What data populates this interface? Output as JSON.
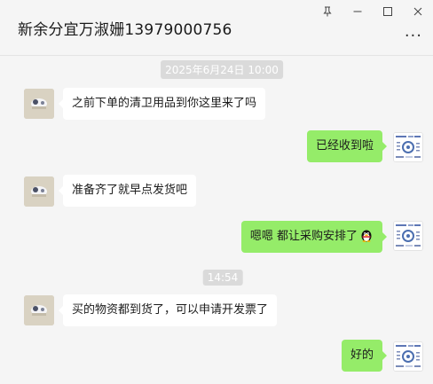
{
  "window": {
    "title": "新余分宜万淑姗13979000756",
    "more_label": "···",
    "controls": {
      "pin_glyph": "⚲",
      "minimize_glyph": "—",
      "maximize_glyph": "☐",
      "close_glyph": "✕"
    }
  },
  "messages": {
    "time1": "2025年6月24日 10:00",
    "m1": "之前下单的清卫用品到你这里来了吗",
    "m2": "已经收到啦",
    "m3": "准备齐了就早点发货吧",
    "m4": "嗯嗯 都让采购安排了",
    "time2": "14:54",
    "m5": "买的物资都到货了，可以申请开发票了",
    "m6": "好的"
  },
  "icons": {
    "left_avatar": "profile-photo-icon",
    "right_avatar": "qr-code-avatar-icon",
    "emoji": "qq-penguin-emoji-icon"
  },
  "colors": {
    "background": "#f5f5f5",
    "bubble_self": "#95ec69",
    "bubble_other": "#ffffff",
    "timestamp_bg": "#dadada"
  }
}
